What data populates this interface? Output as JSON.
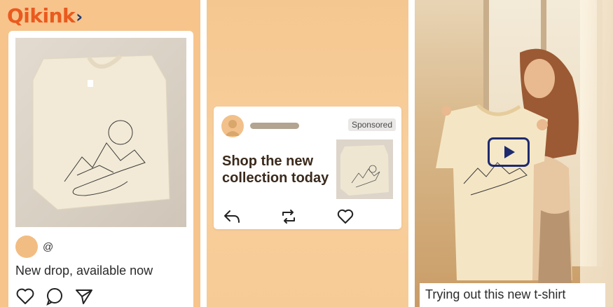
{
  "brand": {
    "name": "Qikink",
    "mark": "›",
    "colors": {
      "text": "#ea5a1e",
      "mark": "#1f3a74"
    }
  },
  "panel1": {
    "post": {
      "handle": "@",
      "caption": "New drop, available now",
      "icons": [
        "heart-icon",
        "comment-icon",
        "send-icon"
      ]
    },
    "background": "#f7c48c"
  },
  "panel2": {
    "ad": {
      "badge": "Sponsored",
      "headline": "Shop the new collection today",
      "icons": [
        "reply-icon",
        "repost-icon",
        "heart-icon"
      ]
    }
  },
  "panel3": {
    "video": {
      "caption": "Trying out this new t-shirt",
      "icon": "play-icon",
      "accent": "#1e2a6e"
    }
  }
}
